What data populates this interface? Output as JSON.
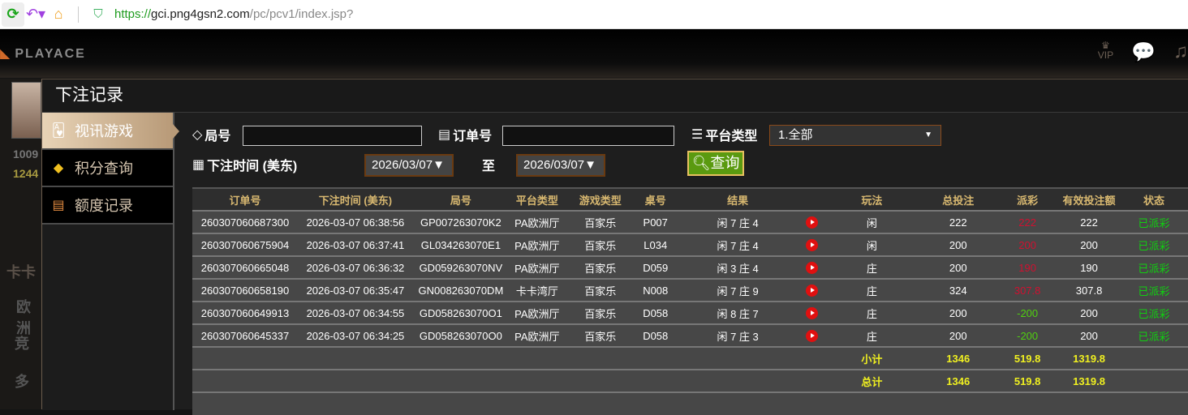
{
  "browser": {
    "url_scheme": "https://",
    "url_host": "gci.png4gsn2.com",
    "url_path": "/pc/pcv1/index.jsp?"
  },
  "header": {
    "logo": "PLAYACE",
    "vip_label": "VIP"
  },
  "background": {
    "balance1": "1009",
    "balance2": "1244",
    "hall1": "卡卡",
    "hall2": "欧洲",
    "hall3": "竞",
    "hall4": "多"
  },
  "modal": {
    "title": "下注记录",
    "tabs": [
      {
        "label": "视讯游戏",
        "icon": "cards-icon"
      },
      {
        "label": "积分查询",
        "icon": "diamond-icon"
      },
      {
        "label": "额度记录",
        "icon": "document-icon"
      }
    ]
  },
  "filters": {
    "round_label": "局号",
    "round_value": "",
    "order_label": "订单号",
    "order_value": "",
    "platform_label": "平台类型",
    "platform_value": "1.全部",
    "time_label": "下注时间 (美东)",
    "date_from": "2026/03/07",
    "to_label": "至",
    "date_to": "2026/03/07",
    "query_label": "查询"
  },
  "table": {
    "headers": [
      "订单号",
      "下注时间 (美东)",
      "局号",
      "平台类型",
      "游戏类型",
      "桌号",
      "结果",
      "",
      "玩法",
      "总投注",
      "派彩",
      "有效投注额",
      "状态"
    ],
    "rows": [
      [
        "260307060687300",
        "2026-03-07 06:38:56",
        "GP007263070K2",
        "PA欧洲厅",
        "百家乐",
        "P007",
        "闲 7 庄 4",
        "闲",
        "222",
        "222",
        "222",
        "已派彩"
      ],
      [
        "260307060675904",
        "2026-03-07 06:37:41",
        "GL034263070E1",
        "PA欧洲厅",
        "百家乐",
        "L034",
        "闲 7 庄 4",
        "闲",
        "200",
        "200",
        "200",
        "已派彩"
      ],
      [
        "260307060665048",
        "2026-03-07 06:36:32",
        "GD059263070NV",
        "PA欧洲厅",
        "百家乐",
        "D059",
        "闲 3 庄 4",
        "庄",
        "200",
        "190",
        "190",
        "已派彩"
      ],
      [
        "260307060658190",
        "2026-03-07 06:35:47",
        "GN008263070DM",
        "卡卡湾厅",
        "百家乐",
        "N008",
        "闲 7 庄 9",
        "庄",
        "324",
        "307.8",
        "307.8",
        "已派彩"
      ],
      [
        "260307060649913",
        "2026-03-07 06:34:55",
        "GD058263070O1",
        "PA欧洲厅",
        "百家乐",
        "D058",
        "闲 8 庄 7",
        "庄",
        "200",
        "-200",
        "200",
        "已派彩"
      ],
      [
        "260307060645337",
        "2026-03-07 06:34:25",
        "GD058263070O0",
        "PA欧洲厅",
        "百家乐",
        "D058",
        "闲 7 庄 3",
        "庄",
        "200",
        "-200",
        "200",
        "已派彩"
      ]
    ],
    "subtotal": {
      "label": "小计",
      "total_bet": "1346",
      "payout": "519.8",
      "valid_bet": "1319.8"
    },
    "total": {
      "label": "总计",
      "total_bet": "1346",
      "payout": "519.8",
      "valid_bet": "1319.8"
    }
  },
  "colors": {
    "payout_win": "#d01030",
    "payout_loss": "#50d010",
    "status": "#10d010",
    "header_text": "#d8b870",
    "summary": "#f0f020"
  }
}
